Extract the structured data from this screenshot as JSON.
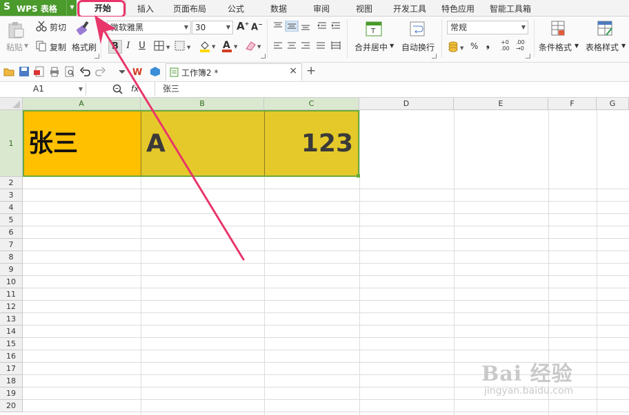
{
  "app": {
    "logo": "S",
    "name": "WPS 表格"
  },
  "menu": {
    "tabs": [
      "开始",
      "插入",
      "页面布局",
      "公式",
      "数据",
      "审阅",
      "视图",
      "开发工具",
      "特色应用",
      "智能工具箱"
    ]
  },
  "ribbon": {
    "paste": "粘贴",
    "cut": "剪切",
    "copy": "复制",
    "format_painter": "格式刷",
    "font_name": "微软雅黑",
    "font_size": "30",
    "bold": "B",
    "italic": "I",
    "underline": "U",
    "merge_center": "合并居中",
    "wrap_text": "自动换行",
    "number_format": "常规",
    "percent": "%",
    "comma": "❟",
    "inc_decimal": ".00",
    "dec_decimal": ".00",
    "conditional_format": "条件格式",
    "table_style": "表格样式"
  },
  "colors": {
    "highlight": "#e8356a",
    "accent": "#4a9a2c",
    "cell_a1": "#ffc000",
    "cell_bc": "#e5c92a",
    "font_accent": "#d43b22"
  },
  "document": {
    "tab_name": "工作簿2 *"
  },
  "formula_bar": {
    "cell_ref": "A1",
    "fx": "fx",
    "content": "张三"
  },
  "grid": {
    "columns": [
      "A",
      "B",
      "C",
      "D",
      "E",
      "F",
      "G"
    ],
    "rows": [
      "1",
      "2",
      "3",
      "4",
      "5",
      "6",
      "7",
      "8",
      "9",
      "10",
      "11",
      "12",
      "13",
      "14",
      "15",
      "16",
      "17",
      "18",
      "19",
      "20"
    ],
    "cells": {
      "A1": "张三",
      "B1": "A",
      "C1": "123"
    }
  },
  "watermark": {
    "brand": "Bai 经验",
    "url": "jingyan.baidu.com"
  }
}
